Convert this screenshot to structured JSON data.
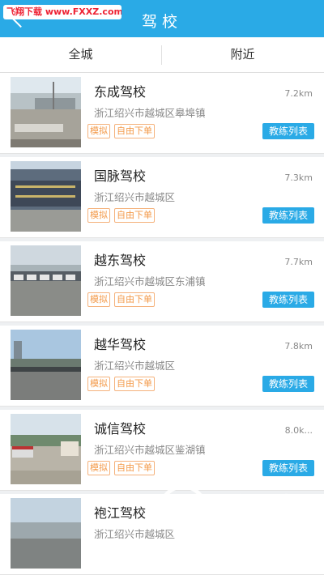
{
  "header": {
    "title": "驾校"
  },
  "watermark": {
    "text": "飞翔下载 www.FXXZ.com",
    "logo_main": "飞翔下载",
    "logo_url": "www.fxxz.com"
  },
  "tabs": [
    {
      "label": "全城"
    },
    {
      "label": "附近"
    }
  ],
  "schools": [
    {
      "name": "东成驾校",
      "distance": "7.2km",
      "address": "浙江绍兴市越城区皋埠镇",
      "tags": [
        "模拟",
        "自由下单"
      ],
      "button": "教练列表"
    },
    {
      "name": "国脉驾校",
      "distance": "7.3km",
      "address": "浙江绍兴市越城区",
      "tags": [
        "模拟",
        "自由下单"
      ],
      "button": "教练列表"
    },
    {
      "name": "越东驾校",
      "distance": "7.7km",
      "address": "浙江绍兴市越城区东浦镇",
      "tags": [
        "模拟",
        "自由下单"
      ],
      "button": "教练列表"
    },
    {
      "name": "越华驾校",
      "distance": "7.8km",
      "address": "浙江绍兴市越城区",
      "tags": [
        "模拟",
        "自由下单"
      ],
      "button": "教练列表"
    },
    {
      "name": "诚信驾校",
      "distance": "8.0k...",
      "address": "浙江绍兴市越城区鉴湖镇",
      "tags": [
        "模拟",
        "自由下单"
      ],
      "button": "教练列表"
    },
    {
      "name": "袍江驾校",
      "distance": "",
      "address": "浙江绍兴市越城区",
      "tags": [],
      "button": ""
    }
  ],
  "colors": {
    "accent": "#2aaae6",
    "tag": "#f39a4a"
  }
}
